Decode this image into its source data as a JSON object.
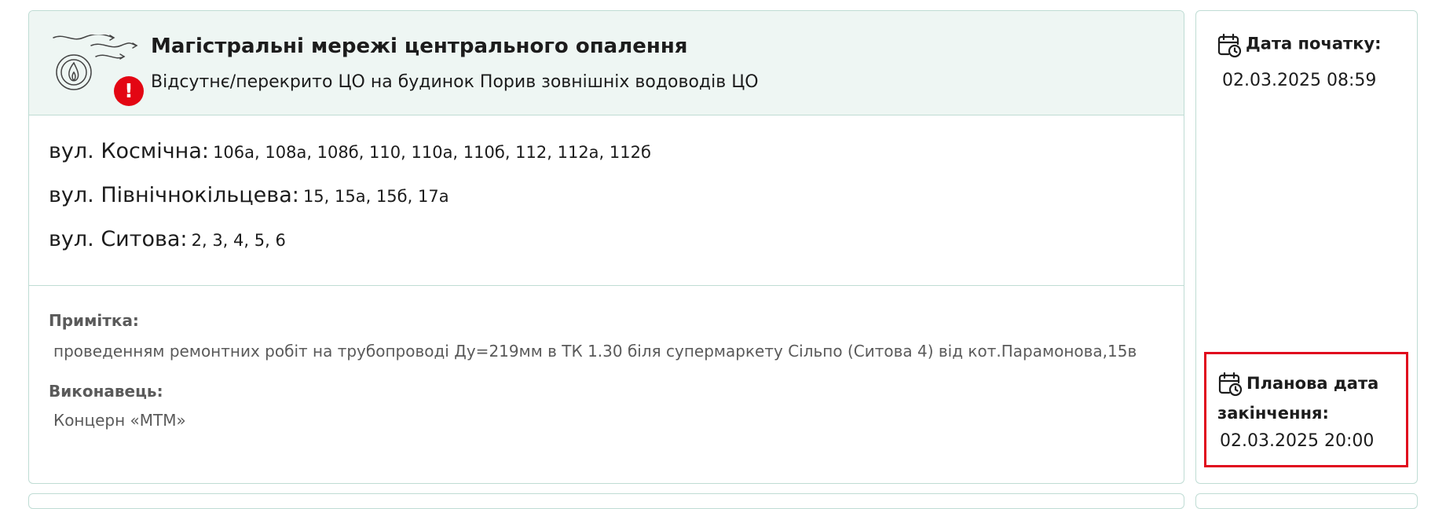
{
  "outage": {
    "service_title": "Магістральні мережі центрального опалення",
    "description": "Відсутнє/перекрито ЦО на будинок Порив зовнішніх водоводів ЦО",
    "alert_glyph": "!",
    "service_icon": "heating-gas-icon",
    "accent_color": "#e30613",
    "addresses": [
      {
        "street": "вул. Космічна:",
        "houses": "106а, 108а, 108б, 110, 110а, 110б, 112, 112а, 112б"
      },
      {
        "street": "вул. Північнокільцева:",
        "houses": "15, 15а, 15б, 17а"
      },
      {
        "street": "вул. Ситова:",
        "houses": "2, 3, 4, 5, 6"
      }
    ],
    "note_label": "Примітка:",
    "note_text": "проведенням ремонтних робіт на трубопроводі Ду=219мм в ТК 1.30 біля супермаркету Сільпо (Ситова 4) від кот.Парамонова,15в",
    "executor_label": "Виконавець:",
    "executor": "Концерн «МТМ»"
  },
  "dates": {
    "start_label": "Дата початку:",
    "start_value": "02.03.2025 08:59",
    "end_label": "Планова дата закінчення:",
    "end_value": "02.03.2025 20:00",
    "icon": "calendar-clock-icon",
    "highlight_color": "#e0081d"
  }
}
